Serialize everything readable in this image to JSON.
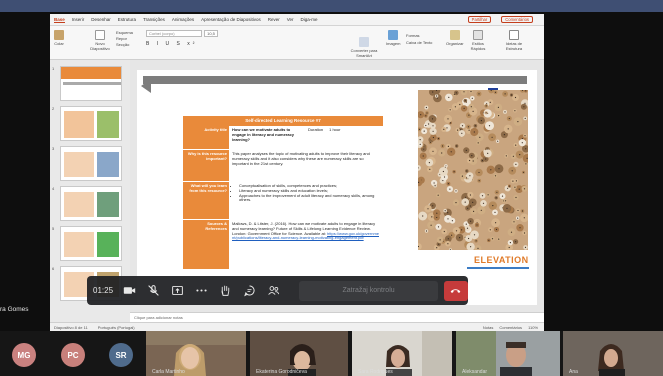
{
  "ppt": {
    "menu": [
      "Base",
      "Inserir",
      "Desenhar",
      "Estrutura",
      "Transições",
      "Animações",
      "Apresentação de Diapositivos",
      "Rever",
      "Ver",
      "Diga-me"
    ],
    "share_label": "Partilhar",
    "comments_label": "Comentários",
    "ribbon": {
      "colar": "Colar",
      "novo_diapositivo": "Novo Diapositivo",
      "esquema": "Esquema",
      "repor": "Repor",
      "seccao": "Secção",
      "font_name": "Corbel (corpo)",
      "font_size": "10,5",
      "converter": "Converter para SmartArt",
      "imagem": "Imagem",
      "caixa_texto": "Caixa de Texto",
      "formas": "Formas",
      "organizar": "Organizar",
      "estilos_rapidos": "Estilos Rápidos",
      "ideias": "Ideias de Estrutura"
    },
    "thumb_numbers": [
      "1",
      "2",
      "3",
      "4",
      "5",
      "6",
      "7",
      "8"
    ],
    "notes_placeholder": "Clique para adicionar notas",
    "status": {
      "left": "Diapositivo 8 de 11",
      "lang": "Português (Portugal)",
      "notas": "Notas",
      "comentarios": "Comentários",
      "zoom": "110%"
    }
  },
  "slide": {
    "eu_label": "Erasmus+",
    "table_title": "Self-directed Learning Resource #7",
    "rows": [
      {
        "label": "Activity title",
        "value": "How can we motivate adults to engage in literacy and numeracy learning?",
        "extra1": "Duration",
        "extra2": "1 hour"
      },
      {
        "label": "Why is this resource important?",
        "value": "This paper analyses the topic of motivating adults to improve their literacy and numeracy skills and it also considers why these are numeracy skills are so important in the 21st century."
      },
      {
        "label": "What will you learn from this resource?",
        "bullets": [
          "Conceptualisation of skills, competences and practices;",
          "Literacy and numeracy skills and education levels;",
          "Approaches to the improvement of adult literacy and numeracy skills, among others."
        ]
      },
      {
        "label": "Sources & References",
        "value": "Mallows, D. & Litster, J. (2016). How can we motivate adults to engage in literacy and numeracy learning? Future of Skills & Lifelong Learning Evidence Review. London: Government Office for Science. Available at:",
        "link": "https://www.gov.uk/government/publications/literacy-and-numeracy-learning-motivating-engagement.pdf"
      }
    ],
    "logo_text": "ELEVATION"
  },
  "call": {
    "timer": "01:25",
    "remote_label": "Zatražaj kontrolu",
    "presenter_label": "ra Gomes",
    "participants": [
      {
        "initials": "MG",
        "color": "#c9817f"
      },
      {
        "initials": "PC",
        "color": "#c8807b"
      },
      {
        "initials": "SR",
        "color": "#4f6b8c"
      }
    ],
    "videos": [
      {
        "name": "Carla Martinho"
      },
      {
        "name": "Ekaterina Gorodničeva"
      },
      {
        "name": "Sara Rodrigues"
      },
      {
        "name": "Aleksandar"
      },
      {
        "name": "Ana"
      }
    ]
  }
}
